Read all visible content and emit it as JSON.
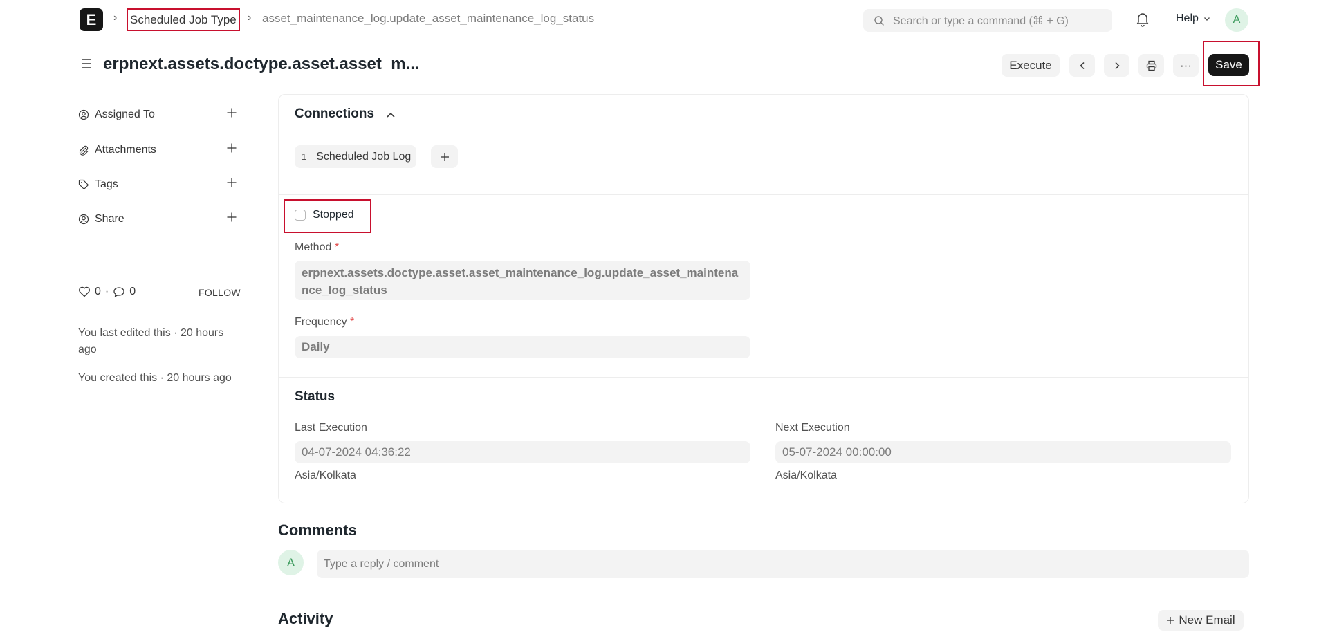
{
  "navbar": {
    "logo_letter": "E",
    "breadcrumbs": [
      "Scheduled Job Type",
      "asset_maintenance_log.update_asset_maintenance_log_status"
    ],
    "search_placeholder": "Search or type a command (⌘ + G)",
    "help_label": "Help",
    "avatar_initial": "A"
  },
  "page": {
    "title": "erpnext.assets.doctype.asset.asset_m...",
    "execute_label": "Execute",
    "more_label": "···",
    "save_label": "Save"
  },
  "sidebar": {
    "items": [
      {
        "label": "Assigned To",
        "icon": "assign-user-icon"
      },
      {
        "label": "Attachments",
        "icon": "paperclip-icon"
      },
      {
        "label": "Tags",
        "icon": "tag-icon"
      },
      {
        "label": "Share",
        "icon": "share-user-icon"
      }
    ],
    "likes": "0",
    "dot": "·",
    "comments_count": "0",
    "follow_label": "FOLLOW",
    "last_edited": "You last edited this · 20 hours ago",
    "created": "You created this · 20 hours ago"
  },
  "connections": {
    "heading": "Connections",
    "links": [
      {
        "count": "1",
        "label": "Scheduled Job Log"
      }
    ]
  },
  "form": {
    "stopped_label": "Stopped",
    "stopped_checked": false,
    "method_label": "Method",
    "method_value": "erpnext.assets.doctype.asset.asset_maintenance_log.update_asset_maintenance_log_status",
    "frequency_label": "Frequency",
    "frequency_value": "Daily",
    "required_mark": "*"
  },
  "status": {
    "heading": "Status",
    "last_execution_label": "Last Execution",
    "last_execution_value": "04-07-2024 04:36:22",
    "last_execution_tz": "Asia/Kolkata",
    "next_execution_label": "Next Execution",
    "next_execution_value": "05-07-2024 00:00:00",
    "next_execution_tz": "Asia/Kolkata"
  },
  "comments": {
    "heading": "Comments",
    "avatar_initial": "A",
    "placeholder": "Type a reply / comment"
  },
  "activity": {
    "heading": "Activity",
    "new_email_label": "New Email"
  },
  "colors": {
    "accent_dark": "#171717",
    "highlight_red": "#c8102e",
    "avatar_green_bg": "#dff3e6",
    "avatar_green_text": "#3a9a5b"
  }
}
